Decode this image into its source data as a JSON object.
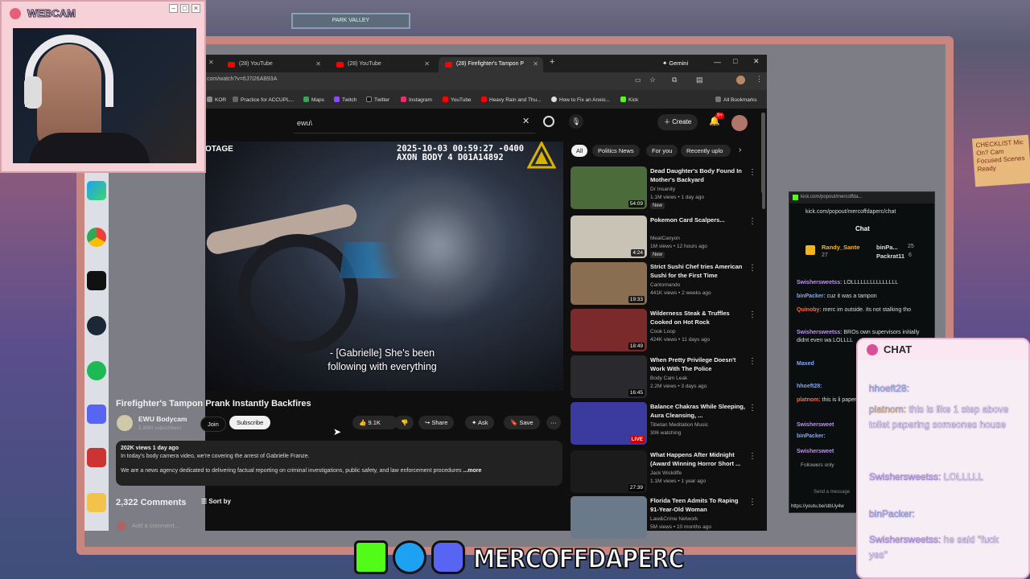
{
  "webcam": {
    "title": "WEBCAM"
  },
  "browser": {
    "tabs": [
      {
        "label": "(28) YouTube"
      },
      {
        "label": "(28) YouTube"
      },
      {
        "label": "(28) Firefighter's Tampon P"
      }
    ],
    "gemini": "Gemini",
    "url": "com/watch?v=6J7i26AB93A",
    "bookmarks": [
      "KOR",
      "Practice for ACCUPL...",
      "Maps",
      "Twitch",
      "Twitter",
      "Instagram",
      "YouTube",
      "Heavy Rain and Thu...",
      "How to Fix an Anxio...",
      "Kick"
    ],
    "all_bookmarks": "All Bookmarks"
  },
  "youtube": {
    "search_value": "ewu\\",
    "create_label": "Create",
    "notif_count": "9+",
    "video": {
      "tag_left": "OTAGE",
      "timestamp_line1": "2025-10-03 00:59:27 -0400",
      "timestamp_line2": "AXON BODY 4 D01A14892",
      "caption_line1": "- [Gabrielle] She's been",
      "caption_line2": "following with everything"
    },
    "title": "Firefighter's Tampon Prank Instantly Backfires",
    "channel": "EWU Bodycam",
    "subscribers": "2.89M subscribers",
    "join": "Join",
    "subscribe": "Subscribe",
    "likes": "9.1K",
    "share": "Share",
    "ask": "Ask",
    "save": "Save",
    "views_line": "202K views  1 day ago",
    "desc_line1": "In today's body camera video, we're covering the arrest of Gabrielle Franze.",
    "desc_line2": "We are a news agency dedicated to delivering factual reporting on criminal investigations, public safety, and law enforcement procedures",
    "more": "...more",
    "comments_count": "2,322 Comments",
    "sort_by": "Sort by",
    "add_comment": "Add a comment...",
    "chips": [
      "All",
      "Politics News",
      "For you",
      "Recently uplo"
    ],
    "recommendations": [
      {
        "title": "Dead Daughter's Body Found In Mother's Backyard",
        "channel": "Dr Insanity",
        "meta": "1.1M views • 1 day ago",
        "badge": "New",
        "duration": "54:09",
        "color": "#4b6b3a"
      },
      {
        "title": "Pokemon Card Scalpers...",
        "channel": "MeatCanyon",
        "meta": "1M views • 12 hours ago",
        "badge": "New",
        "duration": "4:24",
        "color": "#c9c3b5"
      },
      {
        "title": "Strict Sushi Chef tries American Sushi for the First Time",
        "channel": "Cantomando",
        "meta": "441K views • 2 weeks ago",
        "badge": "",
        "duration": "19:33",
        "color": "#8a6e52"
      },
      {
        "title": "Wilderness Steak & Truffles Cooked on Hot Rock",
        "channel": "Cook Loop",
        "meta": "424K views • 11 days ago",
        "badge": "",
        "duration": "18:49",
        "color": "#7a2a2a"
      },
      {
        "title": "When Pretty Privilege Doesn't Work With The Police",
        "channel": "Body Cam Leak",
        "meta": "2.2M views • 3 days ago",
        "badge": "",
        "duration": "16:45",
        "color": "#2a2a2e"
      },
      {
        "title": "Balance Chakras While Sleeping, Aura Cleansing, ...",
        "channel": "Tibetan Meditation Music",
        "meta": "306 watching",
        "badge": "",
        "duration": "LIVE",
        "color": "#3b3a9e"
      },
      {
        "title": "What Happens After Midnight (Award Winning Horror Short ...",
        "channel": "Jack Wickliffe",
        "meta": "1.1M views • 1 year ago",
        "badge": "",
        "duration": "27:39",
        "color": "#1b1b1b"
      },
      {
        "title": "Florida Teen Admits To Raping 91-Year-Old Woman",
        "channel": "Law&Crime Network",
        "meta": "5M views • 10 months ago",
        "badge": "",
        "duration": "",
        "color": "#6b7a8a"
      }
    ]
  },
  "kick": {
    "tab_title": "kick.com/popout/mercoffda...",
    "url": "kick.com/popout/mercoffdaperc/chat",
    "header": "Chat",
    "gifter1": "Randy_Sante",
    "gifter1_count": "27",
    "gifter2": "binPa...",
    "gifter2_count": "25",
    "gifter3": "Packrat11",
    "gifter3_count": "6",
    "messages": [
      {
        "user": "Swishersweetss:",
        "text": " LOLLLLLLLLLLLLLLL",
        "color": "#c48cff"
      },
      {
        "user": "binPacker:",
        "text": " cuz it was a tampon",
        "color": "#7fa8ff"
      },
      {
        "user": "Quinoby:",
        "text": " merc im outside. its not stalking tho",
        "color": "#ff6b4a"
      },
      {
        "user": "Swishersweetss:",
        "text": " BROs own supervisors initially didnt even wa LOLLLL",
        "color": "#c48cff"
      },
      {
        "user": "Maxed",
        "text": "",
        "color": "#7fa8ff"
      },
      {
        "user": "hhoeft28:",
        "text": "",
        "color": "#7fa8ff"
      },
      {
        "user": "platnom:",
        "text": " this is li paper someones",
        "color": "#ff6b4a"
      },
      {
        "user": "Swishersweet",
        "text": "",
        "color": "#c48cff"
      },
      {
        "user": "binPacker:",
        "text": "",
        "color": "#7fa8ff"
      },
      {
        "user": "Swishersweet",
        "text": "",
        "color": "#c48cff"
      }
    ],
    "followers_only": "Followers only",
    "send": "Send a message",
    "status_url": "https://youtu.be/stbUy4w"
  },
  "chat_overlay": {
    "title": "CHAT",
    "messages": [
      {
        "user": "hhoeft28:",
        "text": "",
        "ucolor": "#9ad0ff"
      },
      {
        "user": "platnom:",
        "text": " this is like 1 step above toilet papering someones house",
        "ucolor": "#ffd45a"
      },
      {
        "user": "Swishersweetss:",
        "text": " LOLLLLL",
        "ucolor": "#d8b4ff"
      },
      {
        "user": "binPacker:",
        "text": "",
        "ucolor": "#9ad0ff"
      },
      {
        "user": "Swishersweetss:",
        "text": " he said \"fuck yes\"",
        "ucolor": "#d8b4ff"
      }
    ]
  },
  "banner": {
    "handle": "MERCOFFDAPERC"
  },
  "wall": {
    "sign": "PARK VALLEY",
    "poster": "CHECKLIST Mic On? Cam Focused Scenes Ready"
  }
}
